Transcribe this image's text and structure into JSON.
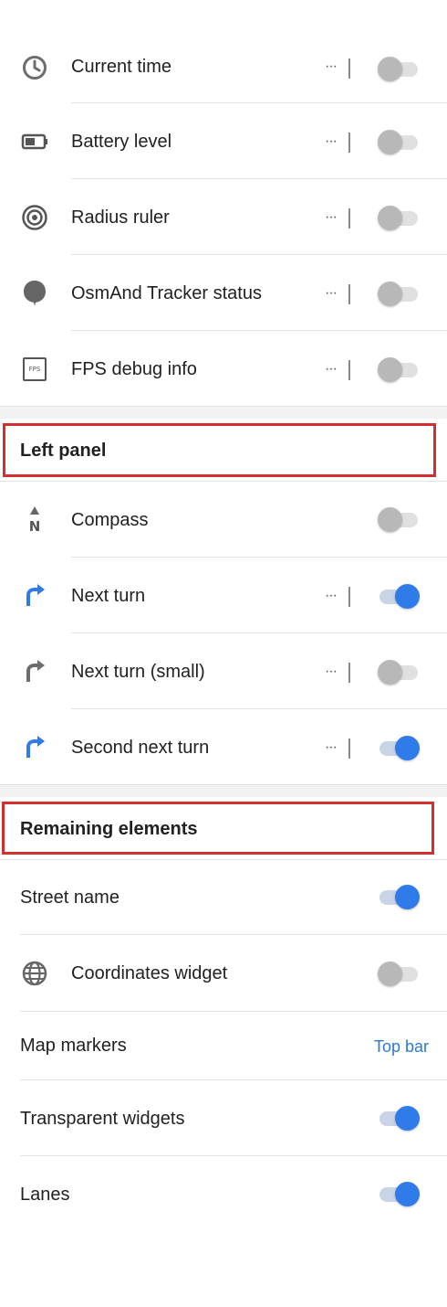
{
  "items_top": [
    {
      "label": "Current time",
      "icon": "clock-icon",
      "has_more": true,
      "enabled": false
    },
    {
      "label": "Battery level",
      "icon": "battery-icon",
      "has_more": true,
      "enabled": false
    },
    {
      "label": "Radius ruler",
      "icon": "radius-ruler-icon",
      "has_more": true,
      "enabled": false
    },
    {
      "label": "OsmAnd Tracker status",
      "icon": "tracker-status-icon",
      "has_more": true,
      "enabled": false
    },
    {
      "label": "FPS debug info",
      "icon": "fps-icon",
      "has_more": true,
      "enabled": false
    }
  ],
  "fps_icon_text": "FPS",
  "more_glyph": "···",
  "left_panel": {
    "title": "Left panel",
    "items": [
      {
        "label": "Compass",
        "icon": "compass-icon",
        "has_more": false,
        "enabled": false
      },
      {
        "label": "Next turn",
        "icon": "turn-arrow-icon",
        "has_more": true,
        "enabled": true
      },
      {
        "label": "Next turn (small)",
        "icon": "turn-arrow-icon",
        "has_more": true,
        "enabled": false
      },
      {
        "label": "Second next turn",
        "icon": "turn-arrow-icon",
        "has_more": true,
        "enabled": true
      }
    ]
  },
  "remaining": {
    "title": "Remaining elements",
    "items": [
      {
        "label": "Street name",
        "enabled": true
      },
      {
        "label": "Coordinates widget",
        "icon": "globe-icon",
        "enabled": false
      },
      {
        "label": "Map markers",
        "value": "Top bar"
      },
      {
        "label": "Transparent widgets",
        "enabled": true
      },
      {
        "label": "Lanes",
        "enabled": true
      }
    ]
  },
  "colors": {
    "accent": "#2f7be9",
    "highlight_border": "#d32f2f",
    "link": "#2a7bd3"
  }
}
